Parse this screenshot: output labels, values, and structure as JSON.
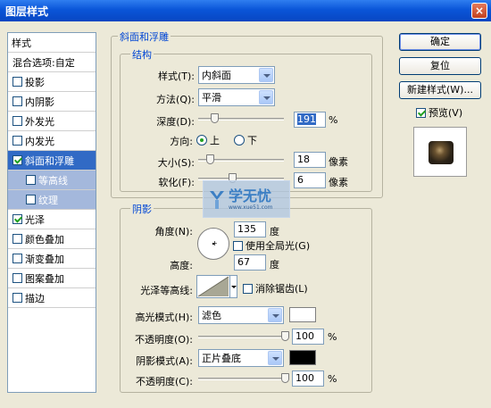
{
  "window": {
    "title": "图层样式",
    "close_glyph": "×"
  },
  "sidebar": {
    "header": "样式",
    "items": [
      {
        "label": "混合选项:自定",
        "type": "plain"
      },
      {
        "label": "投影",
        "checked": false
      },
      {
        "label": "内阴影",
        "checked": false
      },
      {
        "label": "外发光",
        "checked": false
      },
      {
        "label": "内发光",
        "checked": false
      },
      {
        "label": "斜面和浮雕",
        "checked": true,
        "selected": true
      },
      {
        "label": "等高线",
        "checked": false,
        "sub": true
      },
      {
        "label": "纹理",
        "checked": false,
        "sub": true
      },
      {
        "label": "光泽",
        "checked": true
      },
      {
        "label": "颜色叠加",
        "checked": false
      },
      {
        "label": "渐变叠加",
        "checked": false
      },
      {
        "label": "图案叠加",
        "checked": false
      },
      {
        "label": "描边",
        "checked": false
      }
    ]
  },
  "bevel": {
    "group_title": "斜面和浮雕",
    "structure_title": "结构",
    "style": {
      "label": "样式(T):",
      "value": "内斜面"
    },
    "technique": {
      "label": "方法(Q):",
      "value": "平滑"
    },
    "depth": {
      "label": "深度(D):",
      "value": "191",
      "unit": "%"
    },
    "direction": {
      "label": "方向:",
      "up": "上",
      "down": "下",
      "selected": "up"
    },
    "size": {
      "label": "大小(S):",
      "value": "18",
      "unit": "像素"
    },
    "soften": {
      "label": "软化(F):",
      "value": "6",
      "unit": "像素"
    }
  },
  "shading": {
    "title": "阴影",
    "angle": {
      "label": "角度(N):",
      "value": "135",
      "unit": "度"
    },
    "global_light": {
      "label": "使用全局光(G)",
      "checked": false
    },
    "altitude": {
      "label": "高度:",
      "value": "67",
      "unit": "度"
    },
    "gloss_contour": {
      "label": "光泽等高线:"
    },
    "anti_aliased": {
      "label": "消除锯齿(L)",
      "checked": false
    },
    "highlight_mode": {
      "label": "高光模式(H):",
      "value": "滤色",
      "color": "#ffffff"
    },
    "highlight_opacity": {
      "label": "不透明度(O):",
      "value": "100",
      "unit": "%"
    },
    "shadow_mode": {
      "label": "阴影模式(A):",
      "value": "正片叠底",
      "color": "#000000"
    },
    "shadow_opacity": {
      "label": "不透明度(C):",
      "value": "100",
      "unit": "%"
    }
  },
  "buttons": {
    "ok": "确定",
    "reset": "复位",
    "new_style": "新建样式(W)...",
    "preview": {
      "label": "预览(V)",
      "checked": true
    }
  },
  "watermark": {
    "text": "学无忧",
    "url": "www.xue51.com"
  }
}
